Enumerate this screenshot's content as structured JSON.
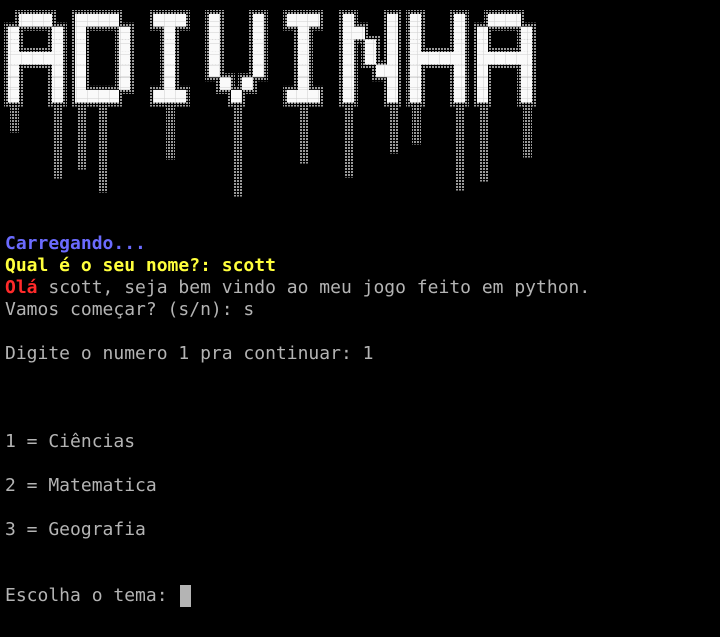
{
  "banner": {
    "word": "ADIVINHA"
  },
  "terminal": {
    "loading": "Carregando...",
    "name_prompt": "Qual é o seu nome?: scott",
    "greet_hi": "Olá",
    "greet_rest": " scott, seja bem vindo ao meu jogo feito em python.",
    "start_prompt": "Vamos começar? (s/n): s",
    "continue_prompt": "Digite o numero 1 pra continuar: 1",
    "options": [
      "1 = Ciências",
      "2 = Matematica",
      "3 = Geografia"
    ],
    "theme_prompt": "Escolha o tema:"
  }
}
